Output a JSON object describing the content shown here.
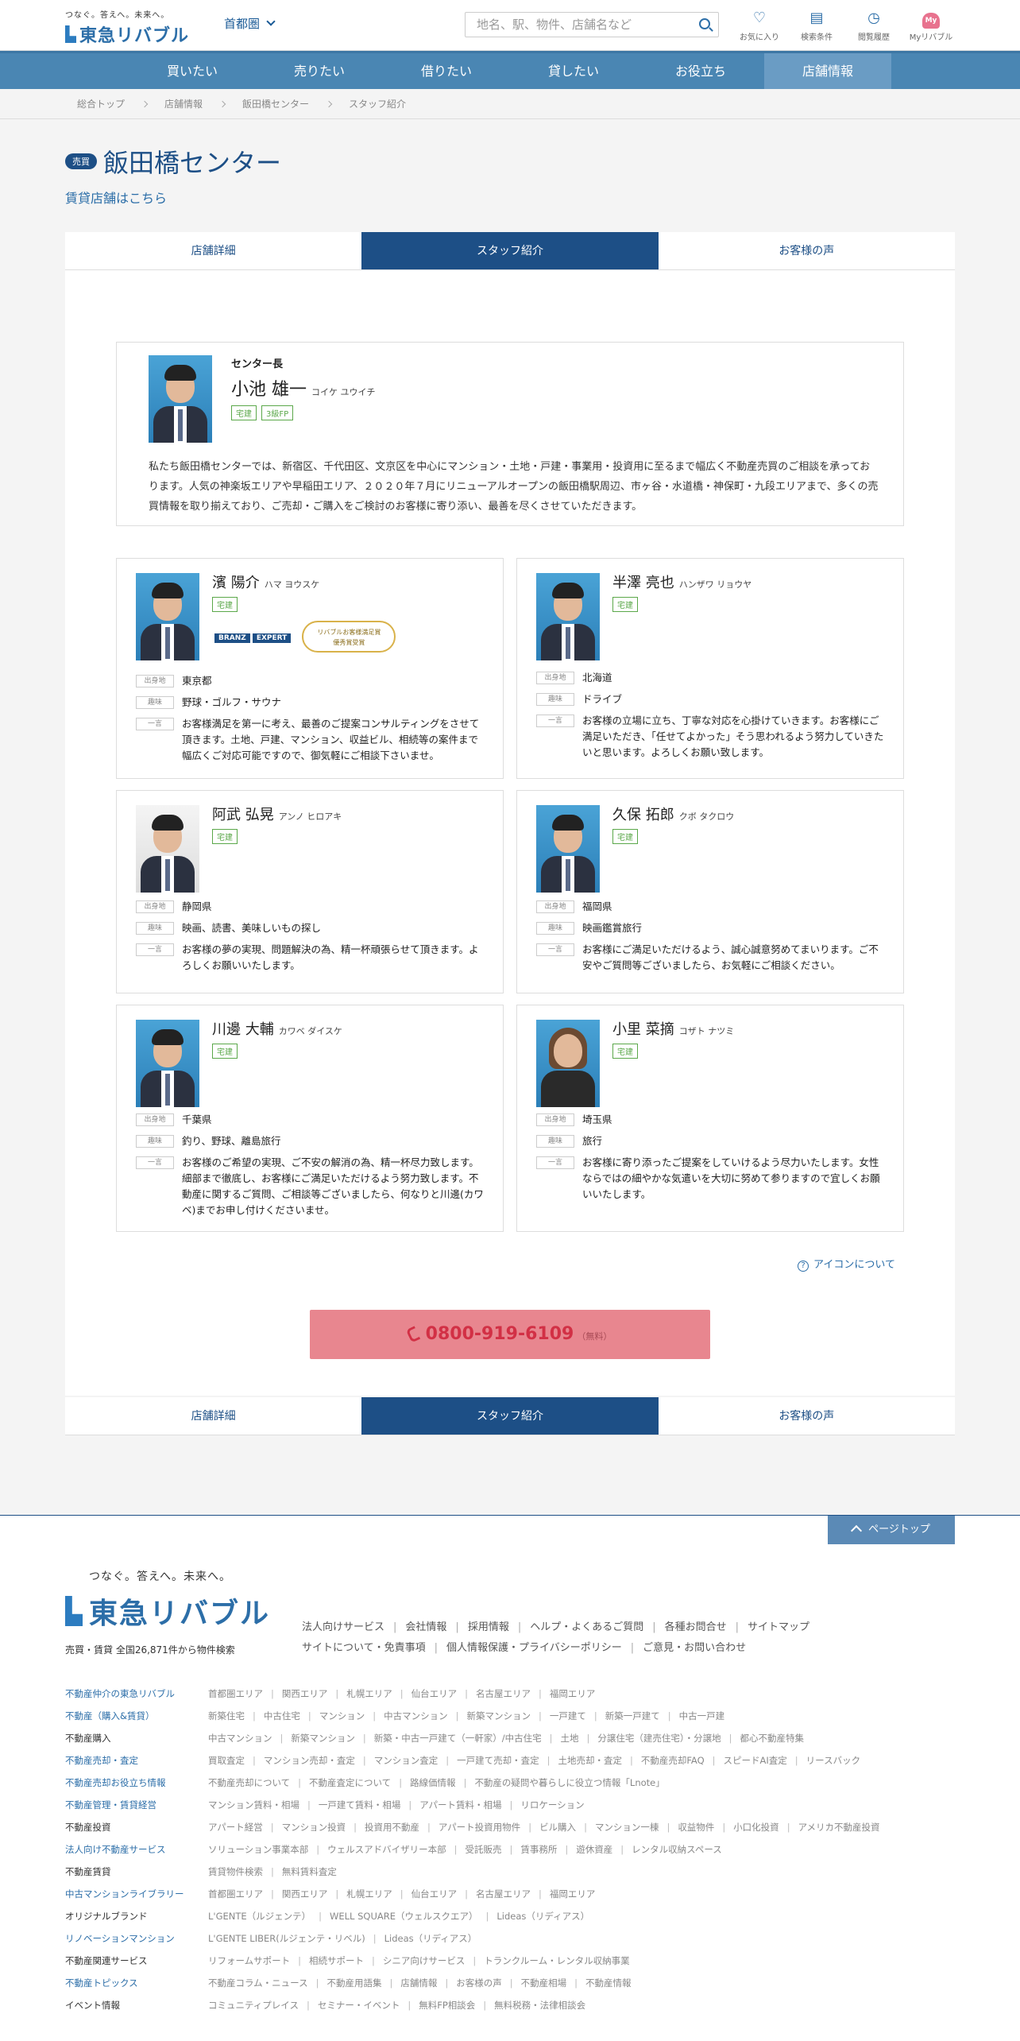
{
  "header": {
    "logo_tagline": "つなぐ。答えへ。未来へ。",
    "logo_name": "東急リバブル",
    "area": "首都圏",
    "search_placeholder": "地名、駅、物件、店舗名など",
    "icons": [
      {
        "label": "お気に入り",
        "icon": "heart-icon"
      },
      {
        "label": "検索条件",
        "icon": "document-icon"
      },
      {
        "label": "閲覧履歴",
        "icon": "clock-icon"
      },
      {
        "label": "Myリバブル",
        "icon": "my-icon"
      }
    ],
    "my_badge": "My"
  },
  "gnav": [
    "買いたい",
    "売りたい",
    "借りたい",
    "貸したい",
    "お役立ち",
    "店舗情報"
  ],
  "breadcrumb": [
    "総合トップ",
    "店舗情報",
    "飯田橋センター",
    "スタッフ紹介"
  ],
  "page": {
    "badge": "売買",
    "title": "飯田橋センター",
    "rent_link": "賃貸店舗はこちら"
  },
  "tabs": [
    "店舗詳細",
    "スタッフ紹介",
    "お客様の声"
  ],
  "manager": {
    "role": "センター長",
    "name": "小池 雄一",
    "kana": "コイケ ユウイチ",
    "licenses": [
      "宅建",
      "3級FP"
    ],
    "intro": "私たち飯田橋センターでは、新宿区、千代田区、文京区を中心にマンション・土地・戸建・事業用・投資用に至るまで幅広く不動産売買のご相談を承っております。人気の神楽坂エリアや早稲田エリア、２０２０年７月にリニューアルオープンの飯田橋駅周辺、市ヶ谷・水道橋・神保町・九段エリアまで、多くの売買情報を取り揃えており、ご売却・ご購入をご検討のお客様に寄り添い、最善を尽くさせていただきます。"
  },
  "labels": {
    "origin": "出身地",
    "hobby": "趣味",
    "comment": "一言"
  },
  "award": {
    "branz": "BRANZ",
    "expert": "EXPERT",
    "medal": "リバブルお客様満足賞\n優秀賞受賞"
  },
  "staff": [
    {
      "name": "濱 陽介",
      "kana": "ハマ ヨウスケ",
      "license": "宅建",
      "origin": "東京都",
      "hobby": "野球・ゴルフ・サウナ",
      "comment": "お客様満足を第一に考え、最善のご提案コンサルティングをさせて頂きます。土地、戸建、マンション、収益ビル、相続等の案件まで幅広くご対応可能ですので、御気軽にご相談下さいませ。"
    },
    {
      "name": "半澤 亮也",
      "kana": "ハンザワ リョウヤ",
      "license": "宅建",
      "origin": "北海道",
      "hobby": "ドライブ",
      "comment": "お客様の立場に立ち、丁寧な対応を心掛けていきます。お客様にご満足いただき、「任せてよかった」そう思われるよう努力していきたいと思います。よろしくお願い致します。"
    },
    {
      "name": "阿武 弘晃",
      "kana": "アンノ ヒロアキ",
      "license": "宅建",
      "origin": "静岡県",
      "hobby": "映画、読書、美味しいもの探し",
      "comment": "お客様の夢の実現、問題解決の為、精一杯頑張らせて頂きます。よろしくお願いいたします。"
    },
    {
      "name": "久保 拓郎",
      "kana": "クボ タクロウ",
      "license": "宅建",
      "origin": "福岡県",
      "hobby": "映画鑑賞旅行",
      "comment": "お客様にご満足いただけるよう、誠心誠意努めてまいります。ご不安やご質問等ございましたら、お気軽にご相談ください。"
    },
    {
      "name": "川邊 大輔",
      "kana": "カワベ ダイスケ",
      "license": "宅建",
      "origin": "千葉県",
      "hobby": "釣り、野球、離島旅行",
      "comment": "お客様のご希望の実現、ご不安の解消の為、精一杯尽力致します。細部まで徹底し、お客様にご満足いただけるよう努力致します。不動産に関するご質問、ご相談等ございましたら、何なりと川邊(カワベ)までお申し付けくださいませ。"
    },
    {
      "name": "小里 菜摘",
      "kana": "コザト ナツミ",
      "license": "宅建",
      "origin": "埼玉県",
      "hobby": "旅行",
      "comment": "お客様に寄り添ったご提案をしていけるよう尽力いたします。女性ならではの細やかな気遣いを大切に努めて参りますので宜しくお願いいたします。"
    }
  ],
  "about_icons": "アイコンについて",
  "tel": {
    "number": "0800-919-6109",
    "note": "（無料）"
  },
  "footer": {
    "pagetop": "ページトップ",
    "tagline": "つなぐ。答えへ。未来へ。",
    "logo": "東急リバブル",
    "count": "売買・賃貸 全国26,871件から物件検索",
    "links": [
      "法人向けサービス",
      "会社情報",
      "採用情報",
      "ヘルプ・よくあるご質問",
      "各種お問合せ",
      "サイトマップ",
      "サイトについて・免責事項",
      "個人情報保護・プライバシーポリシー",
      "ご意見・お問い合わせ"
    ],
    "sitemap": [
      {
        "h": "不動産仲介の東急リバブル",
        "items": [
          "首都圏エリア",
          "関西エリア",
          "札幌エリア",
          "仙台エリア",
          "名古屋エリア",
          "福岡エリア"
        ]
      },
      {
        "h": "不動産（購入&賃貸）",
        "items": [
          "新築住宅",
          "中古住宅",
          "マンション",
          "中古マンション",
          "新築マンション",
          "一戸建て",
          "新築一戸建て",
          "中古一戸建"
        ]
      },
      {
        "h": "不動産購入",
        "items": [
          "中古マンション",
          "新築マンション",
          "新築・中古一戸建て（一軒家）/中古住宅",
          "土地",
          "分譲住宅（建売住宅）・分譲地",
          "都心不動産特集"
        ]
      },
      {
        "h": "不動産売却・査定",
        "items": [
          "買取査定",
          "マンション売却・査定",
          "マンション査定",
          "一戸建て売却・査定",
          "土地売却・査定",
          "不動産売却FAQ",
          "スピードAI査定",
          "リースバック"
        ]
      },
      {
        "h": "不動産売却お役立ち情報",
        "items": [
          "不動産売却について",
          "不動産査定について",
          "路線価情報",
          "不動産の疑問や暮らしに役立つ情報「Lnote」"
        ]
      },
      {
        "h": "不動産管理・賃貸経営",
        "items": [
          "マンション賃料・相場",
          "一戸建て賃料・相場",
          "アパート賃料・相場",
          "リロケーション"
        ]
      },
      {
        "h": "不動産投資",
        "items": [
          "アパート経営",
          "マンション投資",
          "投資用不動産",
          "アパート投資用物件",
          "ビル購入",
          "マンション一棟",
          "収益物件",
          "小口化投資",
          "アメリカ不動産投資"
        ]
      },
      {
        "h": "法人向け不動産サービス",
        "items": [
          "ソリューション事業本部",
          "ウェルスアドバイザリー本部",
          "受託販売",
          "賃事務所",
          "遊休資産",
          "レンタル収納スペース"
        ]
      },
      {
        "h": "不動産賃貸",
        "items": [
          "賃貸物件検索",
          "無料賃料査定"
        ]
      },
      {
        "h": "中古マンションライブラリー",
        "items": [
          "首都圏エリア",
          "関西エリア",
          "札幌エリア",
          "仙台エリア",
          "名古屋エリア",
          "福岡エリア"
        ]
      },
      {
        "h": "オリジナルブランド",
        "items": [
          "L'GENTE（ルジェンテ）",
          "WELL SQUARE（ウェルスクエア）",
          "Lideas（リディアス）"
        ]
      },
      {
        "h": "リノベーションマンション",
        "items": [
          "L'GENTE LIBER(ルジェンテ・リベル)",
          "Lideas（リディアス）"
        ]
      },
      {
        "h": "不動産関連サービス",
        "items": [
          "リフォームサポート",
          "相続サポート",
          "シニア向けサービス",
          "トランクルーム・レンタル収納事業"
        ]
      },
      {
        "h": "不動産トピックス",
        "items": [
          "不動産コラム・ニュース",
          "不動産用語集",
          "店舗情報",
          "お客様の声",
          "不動産相場",
          "不動産情報"
        ]
      },
      {
        "h": "イベント情報",
        "items": [
          "コミュニティプレイス",
          "セミナー・イベント",
          "無料FP相談会",
          "無料税務・法律相談会"
        ]
      }
    ]
  }
}
